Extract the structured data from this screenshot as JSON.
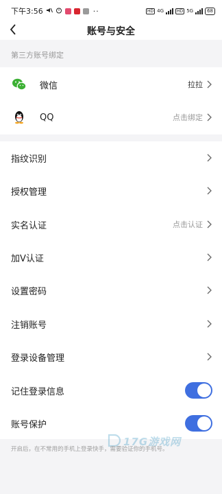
{
  "status_bar": {
    "time": "下午3:56",
    "dots": "··",
    "net_type_1": "4G",
    "net_type_2": "5G",
    "sim_1": "HD",
    "sim_2": "HD",
    "battery": "68"
  },
  "nav": {
    "title": "账号与安全"
  },
  "third_party": {
    "header": "第三方账号绑定",
    "items": [
      {
        "label": "微信",
        "value": "拉拉",
        "icon": "wechat-icon",
        "color": "#3cb034"
      },
      {
        "label": "QQ",
        "value": "点击绑定",
        "icon": "qq-icon"
      }
    ]
  },
  "settings": {
    "items": [
      {
        "label": "指纹识别",
        "value": ""
      },
      {
        "label": "授权管理",
        "value": ""
      },
      {
        "label": "实名认证",
        "value": "点击认证"
      },
      {
        "label": "加V认证",
        "value": ""
      },
      {
        "label": "设置密码",
        "value": ""
      },
      {
        "label": "注销账号",
        "value": ""
      },
      {
        "label": "登录设备管理",
        "value": ""
      },
      {
        "label": "记住登录信息",
        "toggle": true
      },
      {
        "label": "账号保护",
        "toggle": true
      }
    ],
    "footnote": "开启后，在不常用的手机上登录快手，需要验证你的手机号。"
  },
  "watermark": {
    "text": "17G游戏网"
  },
  "colors": {
    "accent": "#3f6fe0",
    "background": "#f4f4f6",
    "secondary_text": "#999999"
  }
}
